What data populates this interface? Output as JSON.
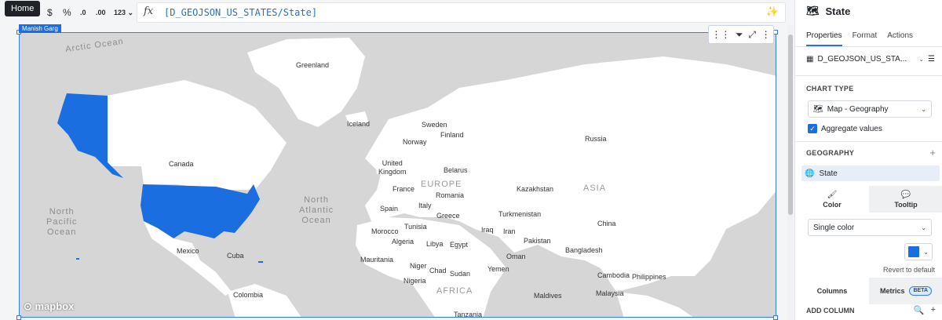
{
  "toolbar": {
    "home_tooltip": "Home",
    "currency": "$",
    "percent": "%",
    "decrease_decimal": ".0",
    "increase_decimal": ".00",
    "number_format": "123",
    "fx_label": "fx",
    "formula": "[D_GEOJSON_US_STATES/State]"
  },
  "map": {
    "user_tag": "Manish Garg",
    "logo": "mapbox",
    "fill_color": "#1a6ee0",
    "labels": {
      "arctic_ocean": "Arctic Ocean",
      "greenland": "Greenland",
      "iceland": "Iceland",
      "sweden": "Sweden",
      "finland": "Finland",
      "norway": "Norway",
      "russia": "Russia",
      "united_kingdom": "United\nKingdom",
      "belarus": "Belarus",
      "europe": "EUROPE",
      "france": "France",
      "romania": "Romania",
      "kazakhstan": "Kazakhstan",
      "asia": "ASIA",
      "spain": "Spain",
      "italy": "Italy",
      "greece": "Greece",
      "turkmenistan": "Turkmenistan",
      "canada": "Canada",
      "north_atlantic": "North\nAtlantic\nOcean",
      "north_pacific": "North\nPacific\nOcean",
      "morocco": "Morocco",
      "tunisia": "Tunisia",
      "iraq": "Iraq",
      "iran": "Iran",
      "china": "China",
      "algeria": "Algeria",
      "libya": "Libya",
      "egypt": "Egypt",
      "pakistan": "Pakistan",
      "mexico": "Mexico",
      "cuba": "Cuba",
      "oman": "Oman",
      "bangladesh": "Bangladesh",
      "mauritania": "Mauritania",
      "niger": "Niger",
      "chad": "Chad",
      "sudan": "Sudan",
      "yemen": "Yemen",
      "nigeria": "Nigeria",
      "cambodia": "Cambodia",
      "philippines": "Philippines",
      "africa": "AFRICA",
      "colombia": "Colombia",
      "maldives": "Maldives",
      "malaysia": "Malaysia",
      "tanzania": "Tanzania"
    }
  },
  "panel": {
    "title": "State",
    "tabs": [
      "Properties",
      "Format",
      "Actions"
    ],
    "source": "D_GEOJSON_US_STA...",
    "chart_type_label": "CHART TYPE",
    "chart_type_value": "Map - Geography",
    "aggregate_label": "Aggregate values",
    "geography_label": "GEOGRAPHY",
    "geography_item": "State",
    "color_tab": "Color",
    "tooltip_tab": "Tooltip",
    "color_mode": "Single color",
    "swatch_color": "#1a6ee0",
    "revert": "Revert to default",
    "columns_tab": "Columns",
    "metrics_tab": "Metrics",
    "beta": "BETA",
    "add_column": "ADD COLUMN"
  }
}
